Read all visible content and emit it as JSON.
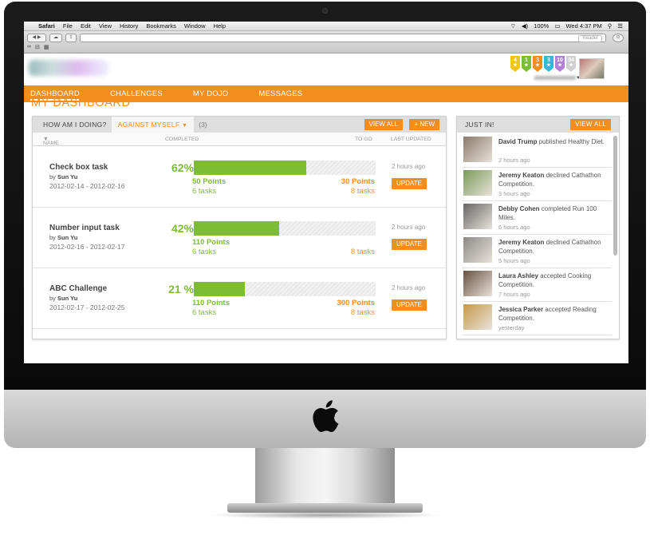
{
  "menubar": {
    "app": "Safari",
    "items": [
      "File",
      "Edit",
      "View",
      "History",
      "Bookmarks",
      "Window",
      "Help"
    ],
    "battery": "100%",
    "clock": "Wed 4:37 PM"
  },
  "toolbar": {
    "reader": "Reader"
  },
  "badges": [
    {
      "value": "4",
      "color": "#f0c419"
    },
    {
      "value": "1",
      "color": "#7cbd33"
    },
    {
      "value": "3",
      "color": "#f28d1e"
    },
    {
      "value": "3",
      "color": "#35b7d6"
    },
    {
      "value": "10",
      "color": "#b07fd6"
    },
    {
      "value": "34",
      "color": "#cfcfcf"
    }
  ],
  "nav": [
    "DASHBOARD",
    "CHALLENGES",
    "MY DOJO",
    "MESSAGES"
  ],
  "page_title": "MY DASHBOARD",
  "panel": {
    "how": "HOW AM I DOING?",
    "against": "AGAINST MYSELF",
    "count": "(3)",
    "view_all": "VIEW ALL",
    "new": "+ NEW",
    "cols": {
      "name": "NAME",
      "completed": "COMPLETED",
      "togo": "TO GO",
      "updated": "LAST UPDATED"
    }
  },
  "rows": [
    {
      "name": "Check box task",
      "by_prefix": "by",
      "by": "Sun Yu",
      "dates": "2012-02-14 - 2012-02-16",
      "pct": "62%",
      "fill": 0.62,
      "pts": "50 Points",
      "tasks": "6 tasks",
      "togo_pts": "30 Points",
      "togo_tasks": "8 tasks",
      "ago": "2 hours ago",
      "update": "UPDATE"
    },
    {
      "name": "Number input task",
      "by_prefix": "by",
      "by": "Sun Yu",
      "dates": "2012-02-16 - 2012-02-17",
      "pct": "42%",
      "fill": 0.47,
      "pts": "110 Points",
      "tasks": "6 tasks",
      "togo_pts": "",
      "togo_tasks": "8 tasks",
      "ago": "2 hours ago",
      "update": "UPDATE"
    },
    {
      "name": "ABC Challenge",
      "by_prefix": "by",
      "by": "Sun Yu",
      "dates": "2012-02-17 - 2012-02-25",
      "pct": "21 %",
      "fill": 0.28,
      "pts": "110 Points",
      "tasks": "6 tasks",
      "togo_pts": "300 Points",
      "togo_tasks": "8 tasks",
      "ago": "2 hours ago",
      "update": "UPDATE"
    }
  ],
  "justin": {
    "title": "JUST IN!",
    "view_all": "VIEW ALL",
    "items": [
      {
        "who": "David Trump",
        "what": "published Healthy Diet.",
        "time": "2 hours ago",
        "pic": "#8a7a6a"
      },
      {
        "who": "Jeremy Keaton",
        "what": "declined Cathathon Competition.",
        "time": "3 hours ago",
        "pic": "#7a9b5a"
      },
      {
        "who": "Debby Cohen",
        "what": "completed Run 100 Miles.",
        "time": "6 hours ago",
        "pic": "#666666"
      },
      {
        "who": "Jeremy Keaton",
        "what": "declined Cathathon Competition.",
        "time": "5 hours ago",
        "pic": "#8d8a86"
      },
      {
        "who": "Laura Ashley",
        "what": "accepted Cooking Competition.",
        "time": "7 hours ago",
        "pic": "#6a5040"
      },
      {
        "who": "Jessica Parker",
        "what": "accepted Reading Competition.",
        "time": "yesterday",
        "pic": "#c59a4a"
      }
    ]
  }
}
